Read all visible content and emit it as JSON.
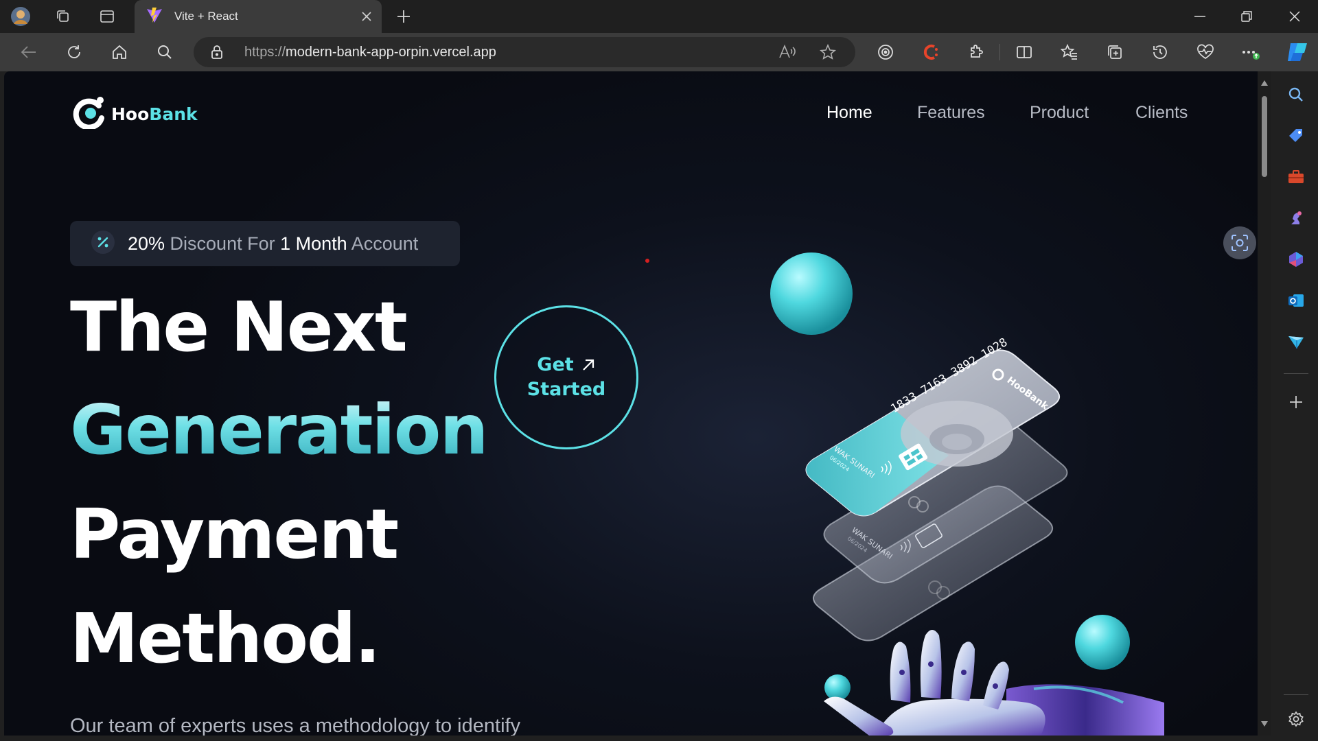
{
  "browser": {
    "tab": {
      "title": "Vite + React"
    },
    "url": {
      "scheme": "https://",
      "host": "modern-bank-app-orpin.vercel.app"
    }
  },
  "page": {
    "logo": {
      "part1": "Hoo",
      "part2": "Bank"
    },
    "nav": [
      {
        "label": "Home",
        "active": true
      },
      {
        "label": "Features",
        "active": false
      },
      {
        "label": "Product",
        "active": false
      },
      {
        "label": "Clients",
        "active": false
      }
    ],
    "badge": {
      "p1": "20%",
      "p2": " Discount For ",
      "p3": "1",
      "p4": " Month",
      "p5": " Account"
    },
    "hero": {
      "line1": "The Next",
      "line2": "Generation",
      "line3": "Payment",
      "line4": "Method."
    },
    "cta": {
      "line1": "Get",
      "line2": "Started"
    },
    "subtitle": "Our team of experts uses a methodology to identify",
    "card_front": {
      "number": "1833 7163 3892 1028",
      "brand": "HooBank",
      "name": "WAK SUNARI",
      "expiry": "06/2024"
    },
    "card_back": {
      "name": "WAK SUNARI",
      "expiry": "06/2024"
    }
  },
  "colors": {
    "accent": "#5ce1e6",
    "page_bg": "#0d111c",
    "chrome": "#3b3b3b"
  }
}
